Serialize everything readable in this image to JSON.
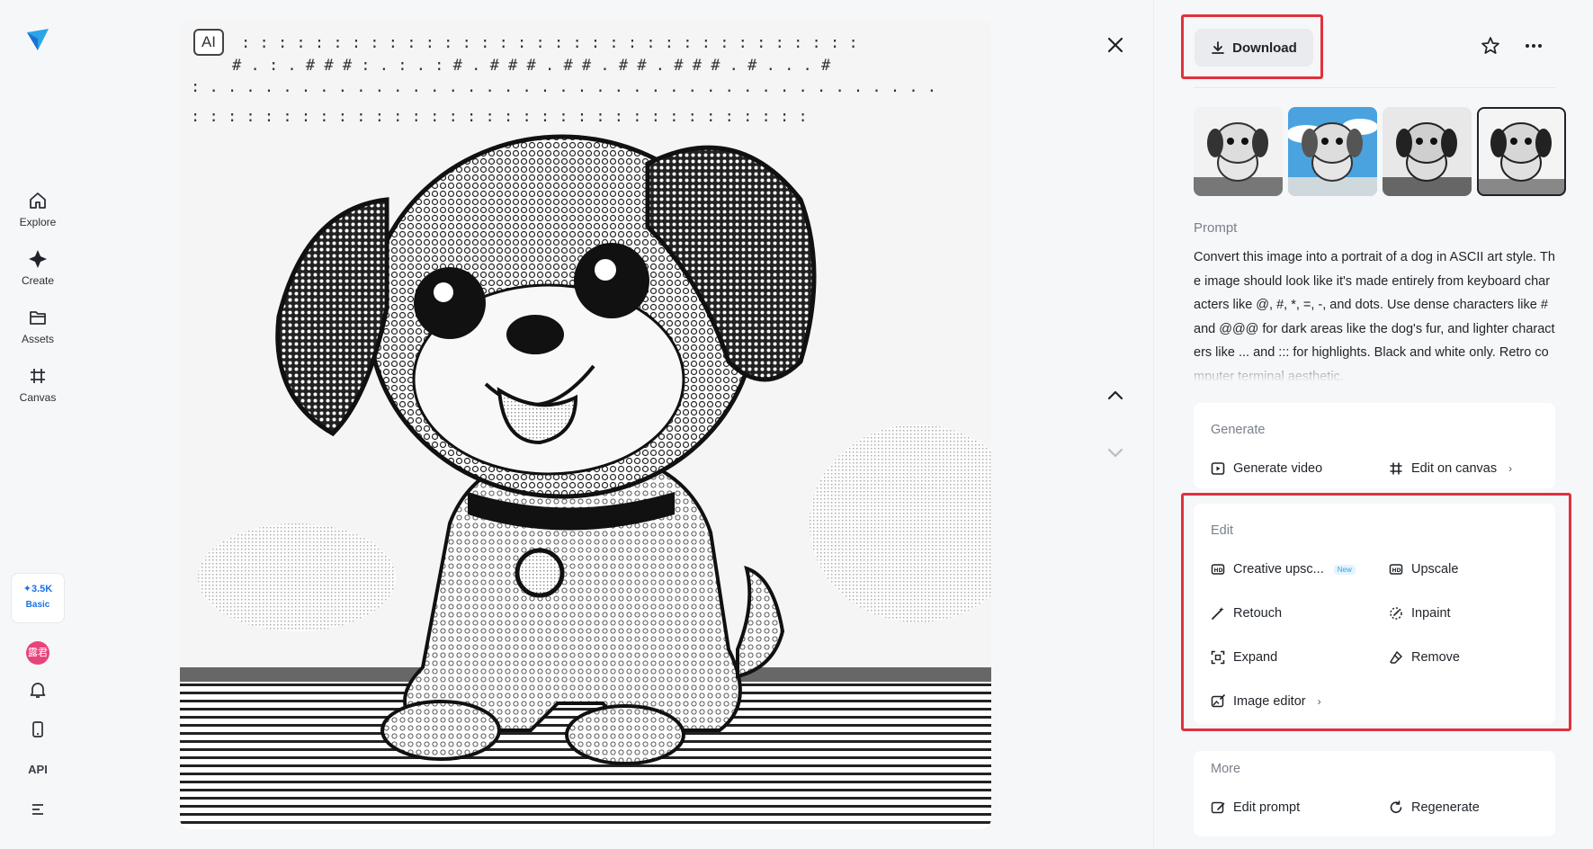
{
  "nav": {
    "items": [
      {
        "label": "Explore",
        "icon": "home-icon"
      },
      {
        "label": "Create",
        "icon": "sparkle-icon"
      },
      {
        "label": "Assets",
        "icon": "folder-icon"
      },
      {
        "label": "Canvas",
        "icon": "canvas-icon"
      }
    ],
    "credits": "3.5K",
    "plan": "Basic",
    "avatar_text": "露君",
    "api_label": "API"
  },
  "viewer": {
    "ai_badge": "AI"
  },
  "panel": {
    "download_label": "Download",
    "prompt_label": "Prompt",
    "prompt_text": "Convert this image into a portrait of a dog in ASCII art style. The image should look like it's made entirely from keyboard characters like @, #, *, =, -, and dots. Use dense characters like # and @@@ for dark areas like the dog's fur, and lighter characters like ... and ::: for highlights. Black and white only. Retro computer terminal aesthetic.",
    "generate": {
      "title": "Generate",
      "generate_video": "Generate video",
      "edit_on_canvas": "Edit on canvas"
    },
    "edit": {
      "title": "Edit",
      "creative_upscale": "Creative upsc...",
      "new_badge": "New",
      "upscale": "Upscale",
      "retouch": "Retouch",
      "inpaint": "Inpaint",
      "expand": "Expand",
      "remove": "Remove",
      "image_editor": "Image editor"
    },
    "more": {
      "title": "More",
      "edit_prompt": "Edit prompt",
      "regenerate": "Regenerate"
    }
  },
  "colors": {
    "accent": "#1a73e8",
    "highlight": "#e0313d"
  }
}
